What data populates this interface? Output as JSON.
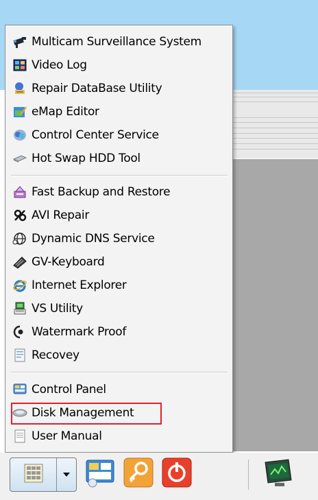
{
  "menu": {
    "items": [
      {
        "label": "Multicam Surveillance System",
        "icon": "surveillance-camera-icon"
      },
      {
        "label": "Video Log",
        "icon": "video-log-icon"
      },
      {
        "label": "Repair DataBase Utility",
        "icon": "repair-database-icon"
      },
      {
        "label": "eMap Editor",
        "icon": "emap-editor-icon"
      },
      {
        "label": "Control Center Service",
        "icon": "control-center-icon"
      },
      {
        "label": "Hot Swap HDD Tool",
        "icon": "hot-swap-hdd-icon"
      },
      {
        "label": "Fast Backup and Restore",
        "icon": "fast-backup-icon"
      },
      {
        "label": "AVI Repair",
        "icon": "avi-repair-icon"
      },
      {
        "label": "Dynamic DNS Service",
        "icon": "dynamic-dns-icon"
      },
      {
        "label": "GV-Keyboard",
        "icon": "gv-keyboard-icon"
      },
      {
        "label": "Internet Explorer",
        "icon": "internet-explorer-icon"
      },
      {
        "label": "VS Utility",
        "icon": "vs-utility-icon"
      },
      {
        "label": "Watermark Proof",
        "icon": "watermark-proof-icon"
      },
      {
        "label": "Recovey",
        "icon": "recovery-icon"
      },
      {
        "label": "Control Panel",
        "icon": "control-panel-icon"
      },
      {
        "label": "Disk Management",
        "icon": "disk-management-icon"
      },
      {
        "label": "User Manual",
        "icon": "user-manual-icon"
      }
    ],
    "highlighted_item": "Disk Management",
    "highlight_color": "#e0202c"
  },
  "taskbar": {
    "buttons": [
      {
        "name": "tools-menu-button",
        "icon": "tools-menu-icon",
        "has_dropdown": true
      },
      {
        "name": "network-settings-button",
        "icon": "network-settings-icon"
      },
      {
        "name": "key-button",
        "icon": "key-icon"
      },
      {
        "name": "power-button",
        "icon": "power-icon"
      },
      {
        "name": "monitor-button",
        "icon": "performance-monitor-icon"
      }
    ]
  }
}
